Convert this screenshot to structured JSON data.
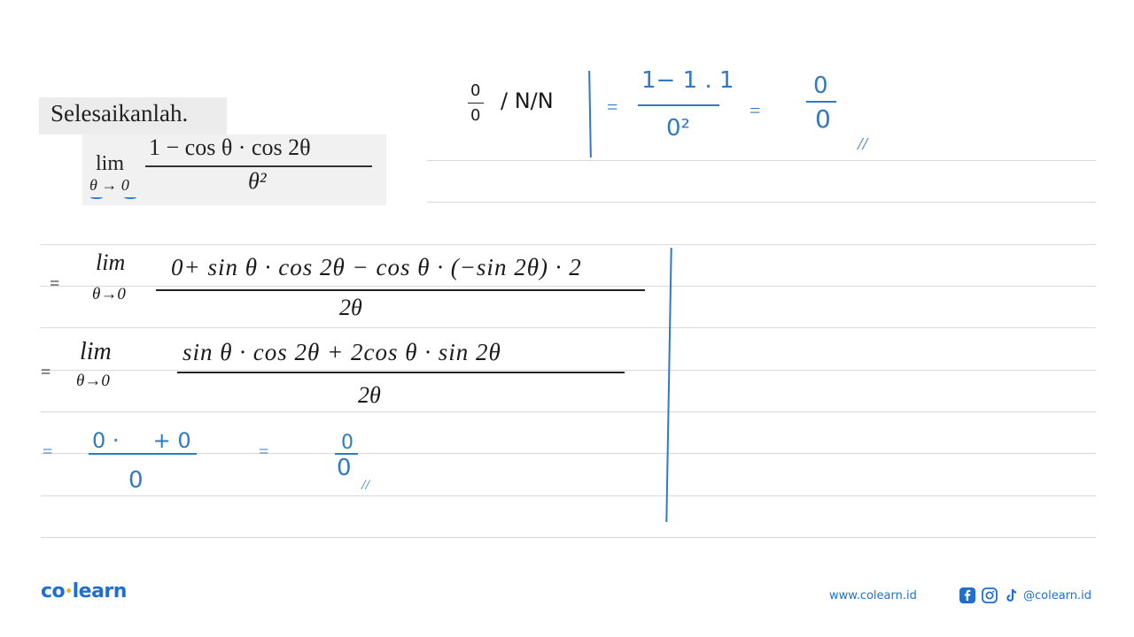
{
  "question": {
    "instruction": "Selesaikanlah.",
    "limit_word": "lim",
    "limit_sub": "θ → 0",
    "numerator": "1 − cos θ · cos 2θ",
    "denominator": "θ²"
  },
  "side_note": {
    "form": "0/0",
    "method_hint": "/ N/N",
    "step_eq1": "=",
    "sub_numerator": "1− 1 . 1",
    "sub_denominator": "0²",
    "step_eq2": "=",
    "result_numerator": "0",
    "result_denominator": "0",
    "end_mark": "//"
  },
  "work": {
    "line1": {
      "eq": "=",
      "lim": "lim",
      "sub": "θ→0",
      "numerator": "0+ sin θ · cos 2θ − cos θ · (−sin 2θ) · 2",
      "denominator": "2θ"
    },
    "line2": {
      "eq": "=",
      "lim": "lim",
      "sub": "θ→0",
      "numerator": "sin θ · cos 2θ + 2cos θ · sin 2θ",
      "denominator": "2θ"
    },
    "line3": {
      "eq": "=",
      "numerator": "0 ·     + 0",
      "denominator": "0",
      "eq2": "=",
      "result_numerator": "0",
      "result_denominator": "0",
      "end_mark": "//"
    }
  },
  "footer": {
    "logo_left": "co",
    "logo_dot": "•",
    "logo_right": "learn",
    "website": "www.colearn.id",
    "social_icons": [
      "facebook-icon",
      "instagram-icon",
      "tiktok-icon"
    ],
    "handle": "@colearn.id"
  },
  "colors": {
    "ink": "#2f7ac0",
    "brand": "#1f6fd1",
    "brand_dot": "#f2b90c",
    "rule": "#d9d9d9"
  }
}
